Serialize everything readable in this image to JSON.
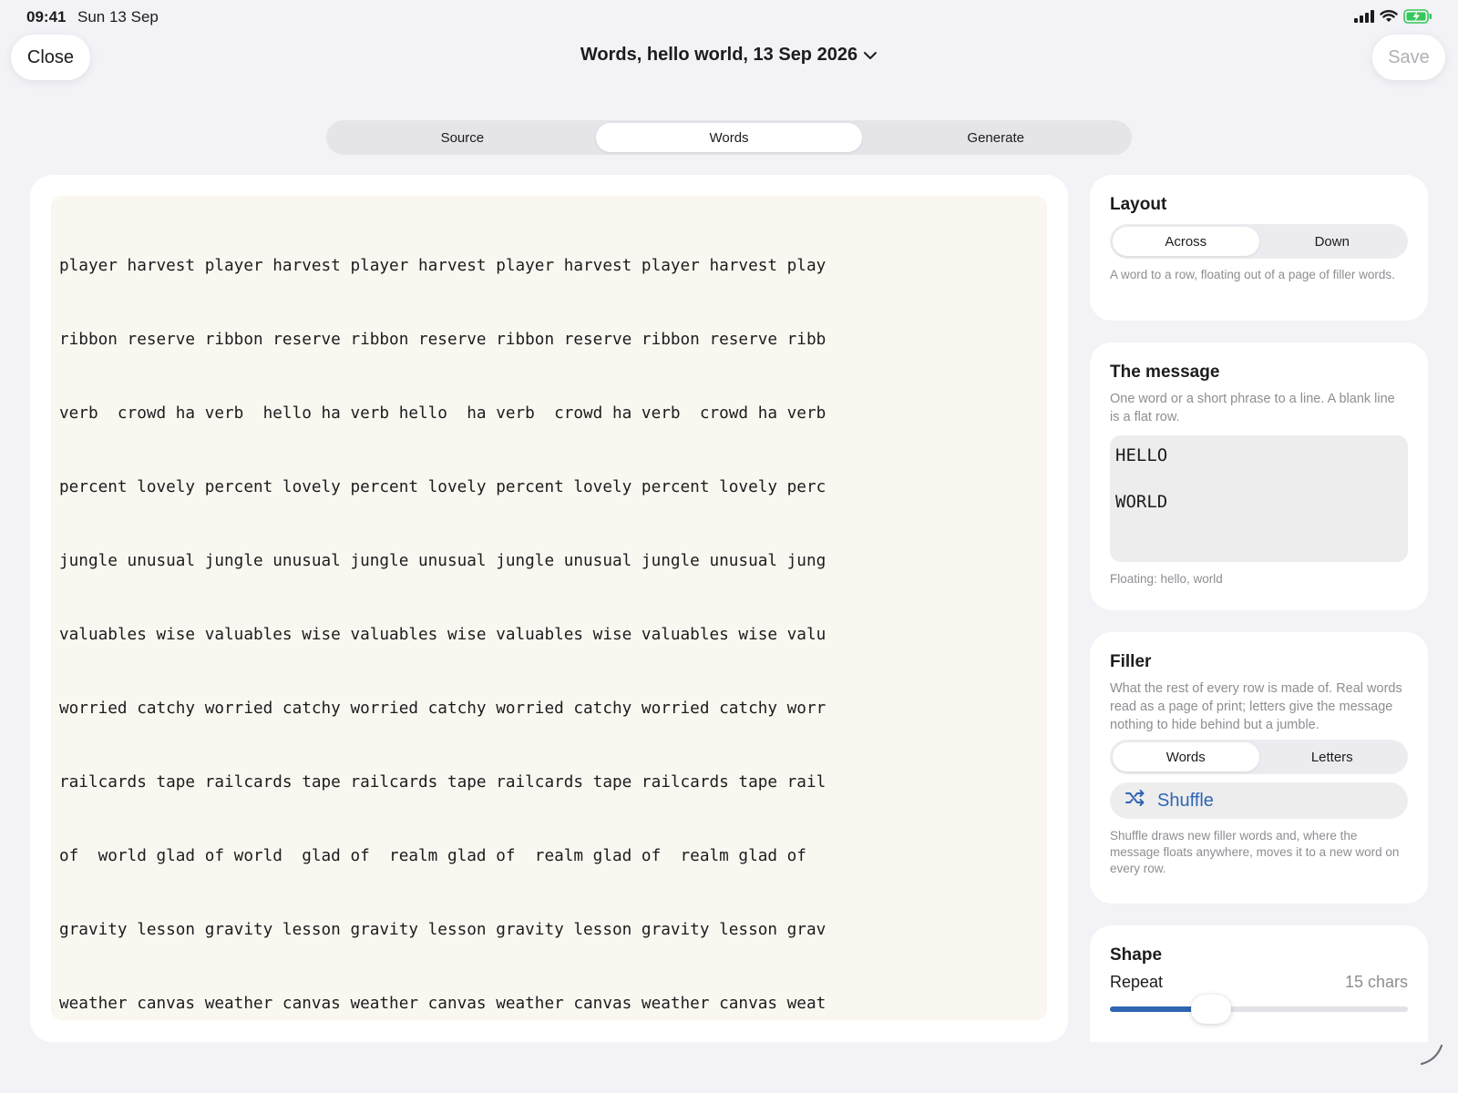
{
  "status": {
    "time": "09:41",
    "date": "Sun 13 Sep",
    "icons": [
      "signal-icon",
      "wifi-icon",
      "battery-charging-icon"
    ]
  },
  "toolbar": {
    "close_label": "Close",
    "save_label": "Save",
    "title": "Words, hello world, 13 Sep 2026"
  },
  "tabs": [
    {
      "label": "Source",
      "active": false
    },
    {
      "label": "Words",
      "active": true
    },
    {
      "label": "Generate",
      "active": false
    }
  ],
  "editor": {
    "lines": [
      "player harvest player harvest player harvest player harvest player harvest play",
      "ribbon reserve ribbon reserve ribbon reserve ribbon reserve ribbon reserve ribb",
      "verb  crowd ha verb  hello ha verb hello  ha verb  crowd ha verb  crowd ha verb",
      "percent lovely percent lovely percent lovely percent lovely percent lovely perc",
      "jungle unusual jungle unusual jungle unusual jungle unusual jungle unusual jung",
      "valuables wise valuables wise valuables wise valuables wise valuables wise valu",
      "worried catchy worried catchy worried catchy worried catchy worried catchy worr",
      "railcards tape railcards tape railcards tape railcards tape railcards tape rail",
      "of  world glad of world  glad of  realm glad of  realm glad of  realm glad of",
      "gravity lesson gravity lesson gravity lesson gravity lesson gravity lesson grav",
      "weather canvas weather canvas weather canvas weather canvas weather canvas weat"
    ]
  },
  "layout_card": {
    "title": "Layout",
    "options": [
      {
        "label": "Across",
        "active": true
      },
      {
        "label": "Down",
        "active": false
      }
    ],
    "description": "A word to a row, floating out of a page of filler words."
  },
  "message_card": {
    "title": "The message",
    "description": "One word or a short phrase to a line. A blank line is a flat row.",
    "lines": [
      "HELLO",
      "",
      "WORLD"
    ],
    "floating": "Floating: hello, world"
  },
  "filler_card": {
    "title": "Filler",
    "description": "What the rest of every row is made of. Real words read as a page of print; letters give the message nothing to hide behind but a jumble.",
    "options": [
      {
        "label": "Words",
        "active": true
      },
      {
        "label": "Letters",
        "active": false
      }
    ],
    "shuffle_label": "Shuffle",
    "shuffle_note": "Shuffle draws new filler words and, where the message floats anywhere, moves it to a new word on every row."
  },
  "shape_card": {
    "title": "Shape",
    "repeat_label": "Repeat",
    "repeat_value": "15 chars",
    "repeat_fraction": 0.34
  },
  "colors": {
    "accent": "#2f66b3",
    "editor_bg": "#f9f7f0",
    "page_bg": "#f2f2f7"
  }
}
